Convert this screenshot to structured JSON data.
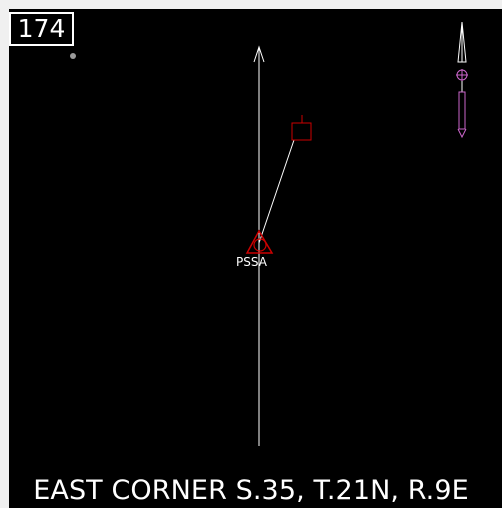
{
  "drawing": {
    "number": "174",
    "station_label": "PSSA",
    "caption": "EAST CORNER S.35, T.21N, R.9E"
  },
  "colors": {
    "background": "#000000",
    "line": "#ffffff",
    "station_symbol": "#cc0000",
    "north_arrow_accent": "#cc66cc"
  },
  "icons": {
    "station": "triangle-circle-icon",
    "target": "square-marker-icon",
    "north": "north-arrow-icon"
  }
}
